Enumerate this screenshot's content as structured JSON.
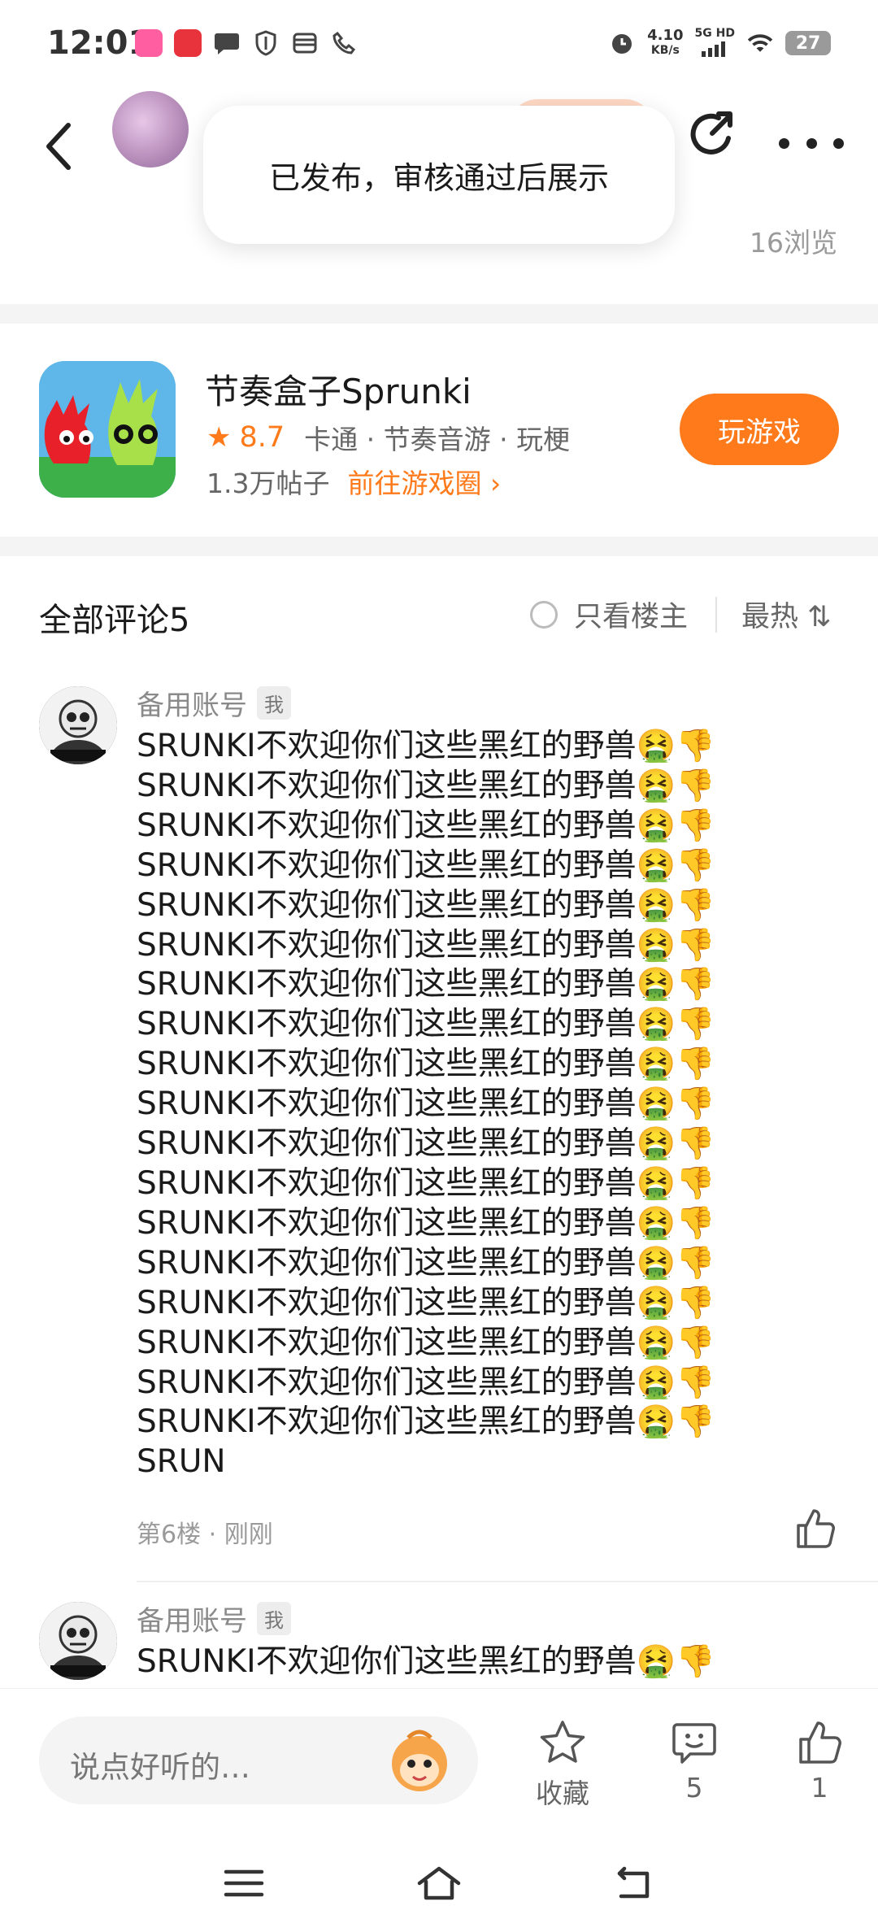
{
  "status_bar": {
    "time": "12:01",
    "net_speed": "4.10",
    "net_unit": "KB/s",
    "signal_label": "5G HD",
    "battery": "27"
  },
  "header": {
    "views": "16浏览",
    "toast": "已发布，审核通过后展示"
  },
  "game": {
    "name": "节奏盒子Sprunki",
    "rating": "8.7",
    "tags": "卡通 · 节奏音游 · 玩梗",
    "posts": "1.3万帖子",
    "goto_label": "前往游戏圈 ›",
    "play_label": "玩游戏"
  },
  "comments_header": {
    "title": "全部评论5",
    "filter_label": "只看楼主",
    "sort_label": "最热 ⇅"
  },
  "comments": [
    {
      "user": "备用账号",
      "badge": "我",
      "text": "SRUNKI不欢迎你们这些黑红的野兽🤮👎\nSRUNKI不欢迎你们这些黑红的野兽🤮👎\nSRUNKI不欢迎你们这些黑红的野兽🤮👎\nSRUNKI不欢迎你们这些黑红的野兽🤮👎\nSRUNKI不欢迎你们这些黑红的野兽🤮👎\nSRUNKI不欢迎你们这些黑红的野兽🤮👎\nSRUNKI不欢迎你们这些黑红的野兽🤮👎\nSRUNKI不欢迎你们这些黑红的野兽🤮👎\nSRUNKI不欢迎你们这些黑红的野兽🤮👎\nSRUNKI不欢迎你们这些黑红的野兽🤮👎\nSRUNKI不欢迎你们这些黑红的野兽🤮👎\nSRUNKI不欢迎你们这些黑红的野兽🤮👎\nSRUNKI不欢迎你们这些黑红的野兽🤮👎\nSRUNKI不欢迎你们这些黑红的野兽🤮👎\nSRUNKI不欢迎你们这些黑红的野兽🤮👎\nSRUNKI不欢迎你们这些黑红的野兽🤮👎\nSRUNKI不欢迎你们这些黑红的野兽🤮👎\nSRUNKI不欢迎你们这些黑红的野兽🤮👎\nSRUN",
      "meta": "第6楼 · 刚刚"
    },
    {
      "user": "备用账号",
      "badge": "我",
      "text": "SRUNKI不欢迎你们这些黑红的野兽🤮👎"
    }
  ],
  "bottom_bar": {
    "input_placeholder": "说点好听的…",
    "collect_label": "收藏",
    "comment_count": "5",
    "like_count": "1"
  },
  "colors": {
    "accent": "#ff7a1a",
    "muted_text": "#9a9a9a",
    "section_bg": "#f4f4f4"
  },
  "icons": [
    "back-icon",
    "share-icon",
    "more-icon",
    "star-icon",
    "chevron-right-icon",
    "radio-icon",
    "like-icon",
    "collect-star-icon",
    "comment-icon",
    "mascot-icon",
    "menu-icon",
    "home-icon",
    "back-nav-icon"
  ]
}
